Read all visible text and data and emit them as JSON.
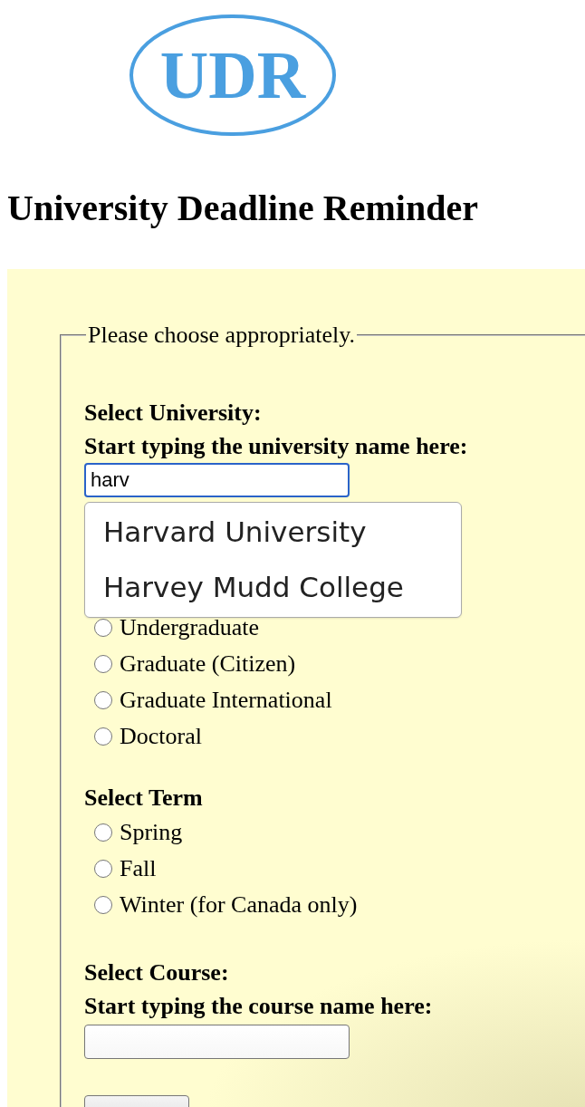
{
  "logo": {
    "text": "UDR"
  },
  "title": "University Deadline Reminder",
  "form": {
    "legend": "Please choose appropriately.",
    "university": {
      "label": "Select University:",
      "hint": "Start typing the university name here:",
      "value": "harv",
      "focused": true,
      "suggestions": [
        "Harvard University",
        "Harvey Mudd College"
      ]
    },
    "level": {
      "options": [
        {
          "label": "Undergraduate",
          "selected": false
        },
        {
          "label": "Graduate (Citizen)",
          "selected": false
        },
        {
          "label": "Graduate International",
          "selected": false
        },
        {
          "label": "Doctoral",
          "selected": false
        }
      ]
    },
    "term": {
      "label": "Select Term",
      "options": [
        {
          "label": "Spring",
          "selected": false
        },
        {
          "label": "Fall",
          "selected": false
        },
        {
          "label": "Winter (for Canada only)",
          "selected": false
        }
      ]
    },
    "course": {
      "label": "Select Course:",
      "hint": "Start typing the course name here:",
      "focused": false
    }
  }
}
